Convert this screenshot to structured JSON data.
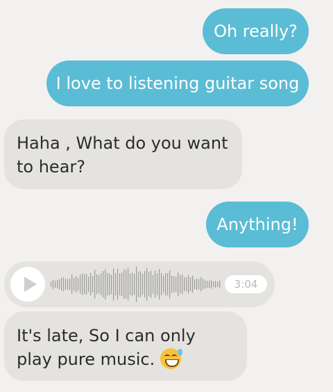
{
  "messages": [
    {
      "direction": "outgoing",
      "text": "Oh really?"
    },
    {
      "direction": "outgoing",
      "text": "I love to listening guitar song"
    },
    {
      "direction": "incoming",
      "text": "Haha , What do you want to hear?"
    },
    {
      "direction": "outgoing",
      "text": "Anything!"
    },
    {
      "direction": "incoming",
      "type": "voice",
      "duration": "3:04",
      "icon": "play-icon"
    },
    {
      "direction": "incoming",
      "text": "It's late, So I can only play pure music.",
      "emoji": "grinning-face-with-sweat-icon"
    }
  ],
  "colors": {
    "background": "#f2f1ef",
    "outgoing_bubble": "#5bbcd5",
    "incoming_bubble": "#e4e3e0",
    "incoming_text": "#2c2c2c"
  }
}
